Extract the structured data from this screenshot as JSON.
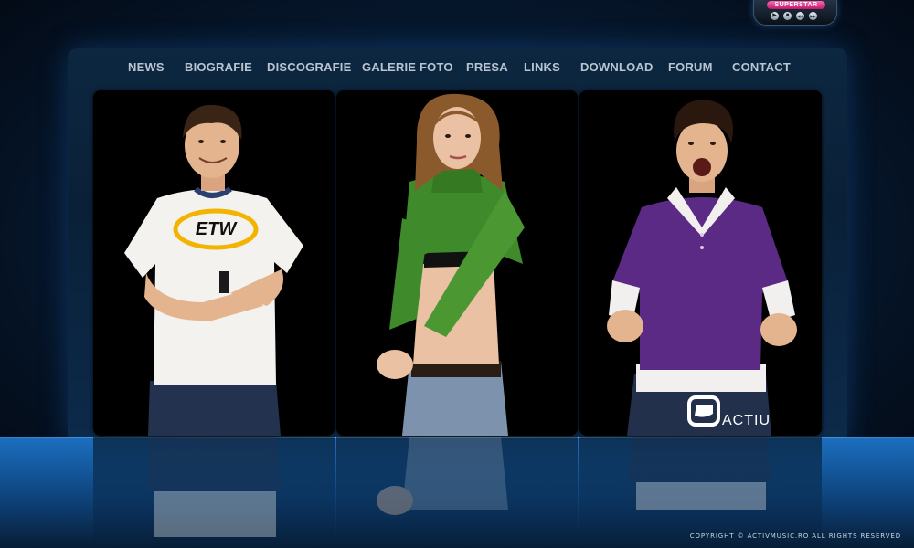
{
  "player": {
    "title": "SUPERSTAR",
    "controls": [
      {
        "icon": "play-icon",
        "glyph": "▶"
      },
      {
        "icon": "stop-icon",
        "glyph": "■"
      },
      {
        "icon": "rewind-icon",
        "glyph": "◀◀"
      },
      {
        "icon": "fast-forward-icon",
        "glyph": "▶▶"
      }
    ]
  },
  "nav": {
    "items": [
      {
        "id": "news",
        "label": "NEWS"
      },
      {
        "id": "biografie",
        "label": "BIOGRAFIE"
      },
      {
        "id": "discografie",
        "label": "DISCOGRAFIE"
      },
      {
        "id": "galerie-foto",
        "label": "GALERIE FOTO"
      },
      {
        "id": "presa",
        "label": "PRESA"
      },
      {
        "id": "links",
        "label": "LINKS"
      },
      {
        "id": "download",
        "label": "DOWNLOAD"
      },
      {
        "id": "forum",
        "label": "FORUM"
      },
      {
        "id": "contact",
        "label": "CONTACT"
      }
    ]
  },
  "cards": [
    {
      "id": "member-left",
      "tshirt_text": "ETW",
      "shirt_color": "#f4f2ee"
    },
    {
      "id": "member-center",
      "shirt_color": "#3f8a2a"
    },
    {
      "id": "member-right",
      "shirt_color": "#5b2a84",
      "logo_text": "ACTIU"
    }
  ],
  "footer": {
    "copyright": "COPYRIGHT © ACTIVMUSIC.RO ALL RIGHTS RESERVED"
  },
  "colors": {
    "nav_text": "#b8c4d0",
    "floor_blue": "#1d6fc0",
    "accent_pink": "#e0338a"
  }
}
